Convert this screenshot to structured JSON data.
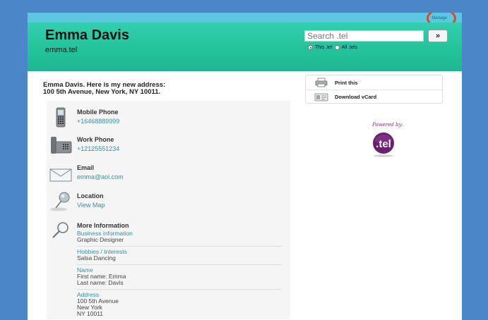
{
  "header": {
    "manage_label": "Manage",
    "name": "Emma Davis",
    "domain": "emma.tel",
    "search": {
      "placeholder": "Search .tel",
      "button_label": "»",
      "scope_this": "This .tel",
      "scope_all": "All .tels",
      "selected": "This .tel"
    }
  },
  "intro": {
    "line1": "Emma Davis. Here is my new address:",
    "line2": "100 5th Avenue, New York, NY 10011."
  },
  "contacts": [
    {
      "title": "Mobile Phone",
      "value": "+16468889999",
      "icon": "mobile-phone-icon"
    },
    {
      "title": "Work Phone",
      "value": "+12125551234",
      "icon": "desk-phone-icon"
    },
    {
      "title": "Email",
      "value": "emma@aol.com",
      "icon": "envelope-icon"
    },
    {
      "title": "Location",
      "value": "View Map",
      "icon": "map-pin-icon"
    }
  ],
  "more_info": {
    "title": "More Information",
    "icon": "magnifier-icon",
    "groups": [
      {
        "label": "Business information",
        "lines": [
          "Graphic Designer"
        ]
      },
      {
        "label": "Hobbies / Interests",
        "lines": [
          "Salsa Dancing"
        ]
      },
      {
        "label": "Name",
        "lines": [
          "First name: Emma",
          "Last name: Davis"
        ]
      },
      {
        "label": "Address",
        "lines": [
          "100 5th Avenue",
          "New York",
          "NY 10011"
        ]
      }
    ]
  },
  "sidebar": {
    "print_label": "Print this",
    "vcard_label": "Download vCard",
    "powered_by": "Powered by:",
    "logo_text": ".tel"
  },
  "colors": {
    "background": "#4a86c8",
    "header_green": "#22c298",
    "top_bar": "#5cc7e3",
    "link": "#2a96a6",
    "highlight_ring": "#d94a2c",
    "logo_purple": "#6a1f6f"
  }
}
